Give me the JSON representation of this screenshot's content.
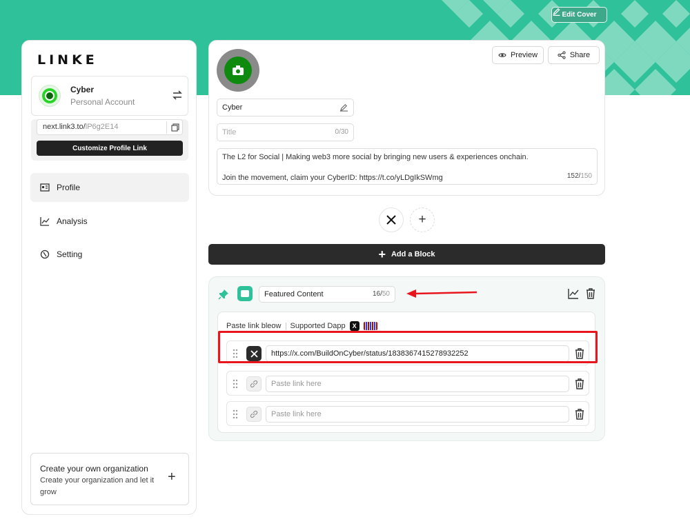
{
  "cover": {
    "edit_cover_label": "Edit Cover",
    "color": "#2fc19a"
  },
  "sidebar": {
    "logo": "LINKE",
    "account": {
      "name": "Cyber",
      "type": "Personal Account"
    },
    "profile_link": {
      "domain": "next.link3.to/",
      "slug": "lP6g2E14"
    },
    "customize_label": "Customize Profile Link",
    "nav": [
      {
        "label": "Profile",
        "icon": "profile-card-icon",
        "active": true
      },
      {
        "label": "Analysis",
        "icon": "line-chart-icon",
        "active": false
      },
      {
        "label": "Setting",
        "icon": "settings-icon",
        "active": false
      }
    ],
    "organization": {
      "title": "Create your own organization",
      "description": "Create your organization and let it grow"
    }
  },
  "profile": {
    "preview_label": "Preview",
    "share_label": "Share",
    "name": "Cyber",
    "title_placeholder": "Title",
    "title_count": "0/30",
    "bio_line1": "The L2 for Social | Making web3 more social by bringing new users & experiences onchain.",
    "bio_line2": "Join the movement, claim your CyberID: https://t.co/yLDgIkSWmg",
    "bio_count_used": "152/",
    "bio_count_max": "150"
  },
  "social": {
    "x_label": "X",
    "add_label": "+"
  },
  "add_block_label": "Add a Block",
  "block": {
    "title": "Featured Content",
    "count_used": "16/",
    "count_max": "50",
    "paste_label": "Paste link bleow",
    "supported_label": "Supported Dapp",
    "links": [
      {
        "value": "https://x.com/BuildOnCyber/status/1838367415278932252",
        "icon": "x-logo-icon",
        "filled": true
      },
      {
        "value": "",
        "placeholder": "Paste link here",
        "icon": "link-icon",
        "filled": false
      },
      {
        "value": "",
        "placeholder": "Paste link here",
        "icon": "link-icon",
        "filled": false
      }
    ]
  },
  "annotation_color": "#e8151c"
}
